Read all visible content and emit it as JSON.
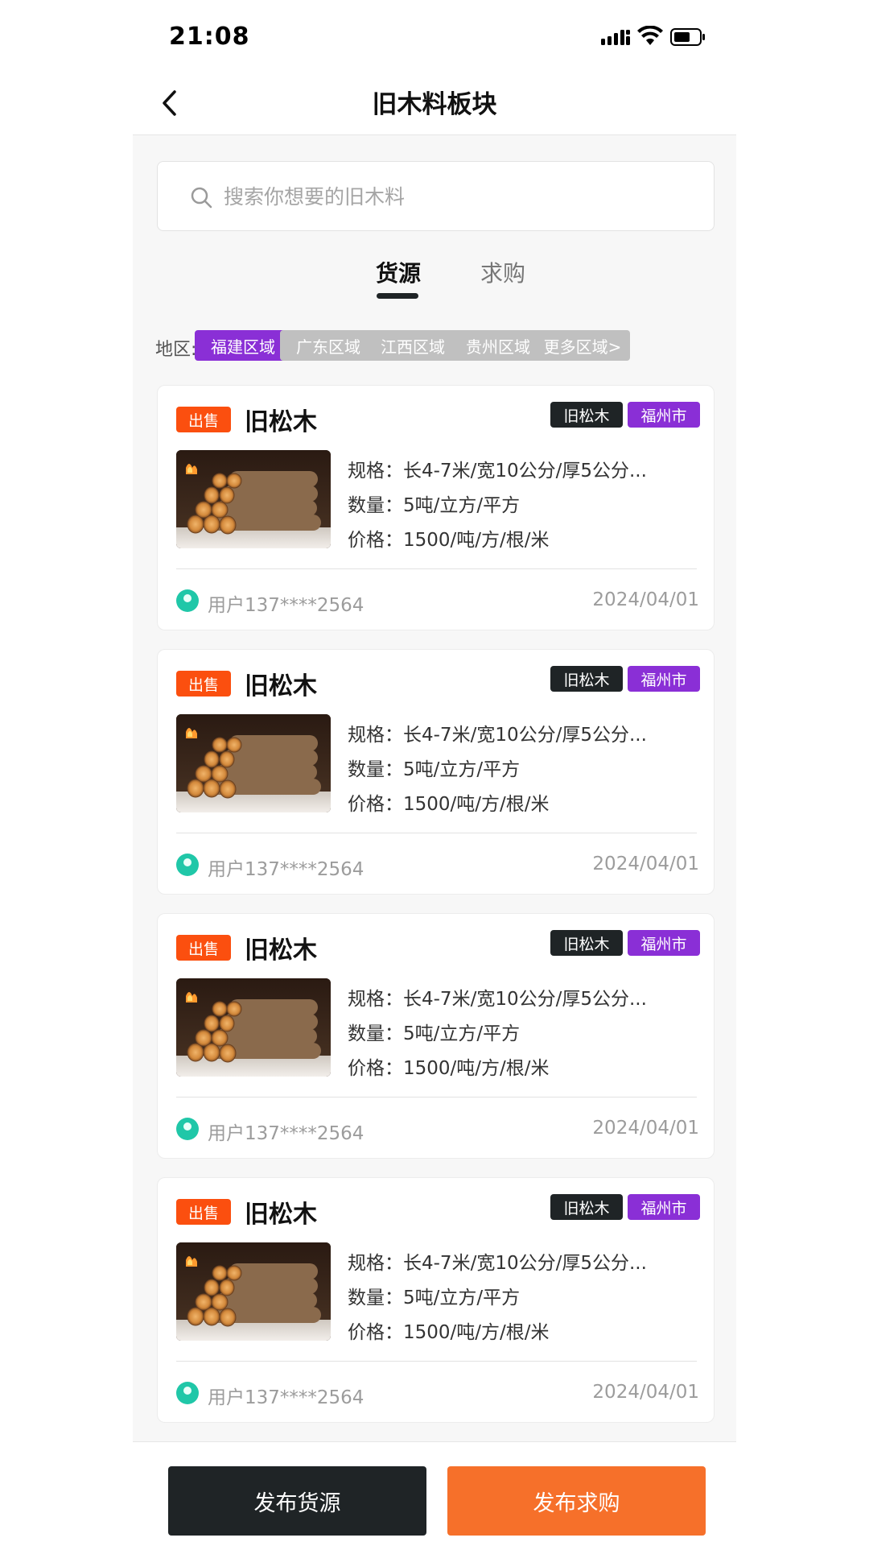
{
  "status_bar": {
    "time": "21:08"
  },
  "nav": {
    "title": "旧木料板块"
  },
  "search": {
    "placeholder": "搜索你想要的旧木料"
  },
  "tabs": [
    {
      "label": "货源",
      "active": true
    },
    {
      "label": "求购",
      "active": false
    }
  ],
  "region": {
    "label": "地区:",
    "chips": [
      {
        "label": "福建区域",
        "active": true
      },
      {
        "label": "广东区域",
        "active": false
      },
      {
        "label": "江西区域",
        "active": false
      },
      {
        "label": "贵州区域",
        "active": false
      },
      {
        "label": "更多区域>",
        "active": false
      }
    ]
  },
  "listings": [
    {
      "badge": "出售",
      "title": "旧松木",
      "tag_wood": "旧松木",
      "tag_city": "福州市",
      "spec": "规格：长4-7米/宽10公分/厚5公分...",
      "qty": "数量：5吨/立方/平方",
      "price": "价格：1500/吨/方/根/米",
      "user": "用户137****2564",
      "date": "2024/04/01"
    },
    {
      "badge": "出售",
      "title": "旧松木",
      "tag_wood": "旧松木",
      "tag_city": "福州市",
      "spec": "规格：长4-7米/宽10公分/厚5公分...",
      "qty": "数量：5吨/立方/平方",
      "price": "价格：1500/吨/方/根/米",
      "user": "用户137****2564",
      "date": "2024/04/01"
    },
    {
      "badge": "出售",
      "title": "旧松木",
      "tag_wood": "旧松木",
      "tag_city": "福州市",
      "spec": "规格：长4-7米/宽10公分/厚5公分...",
      "qty": "数量：5吨/立方/平方",
      "price": "价格：1500/吨/方/根/米",
      "user": "用户137****2564",
      "date": "2024/04/01"
    },
    {
      "badge": "出售",
      "title": "旧松木",
      "tag_wood": "旧松木",
      "tag_city": "福州市",
      "spec": "规格：长4-7米/宽10公分/厚5公分...",
      "qty": "数量：5吨/立方/平方",
      "price": "价格：1500/吨/方/根/米",
      "user": "用户137****2564",
      "date": "2024/04/01"
    }
  ],
  "bottom": {
    "publish_supply": "发布货源",
    "publish_demand": "发布求购"
  },
  "colors": {
    "accent_purple": "#8a2fd6",
    "sale_red": "#fb4f0f",
    "dark": "#1f2426",
    "orange": "#f6702a",
    "user_green": "#20c7a8"
  },
  "icons": [
    "signal-icon",
    "wifi-icon",
    "battery-icon",
    "back-arrow-icon",
    "search-icon",
    "user-avatar-icon"
  ]
}
